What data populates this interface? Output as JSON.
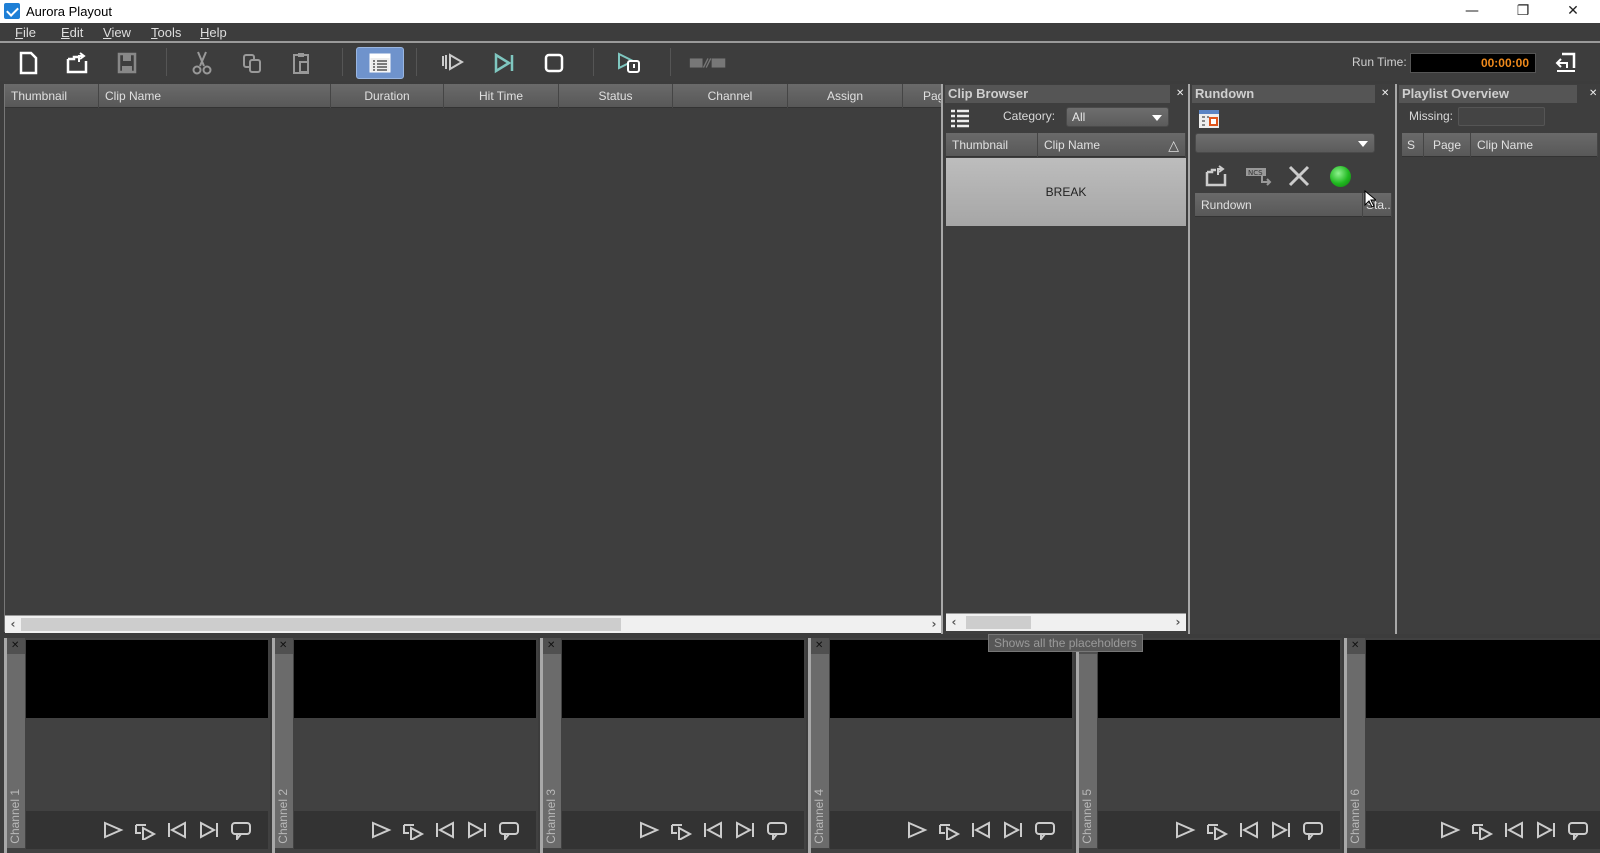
{
  "window": {
    "title": "Aurora Playout",
    "controls": {
      "minimize": "—",
      "restore": "❐",
      "close": "✕"
    }
  },
  "menu": [
    {
      "label": "File",
      "mnemonic": "F",
      "rest": "ile"
    },
    {
      "label": "Edit",
      "mnemonic": "E",
      "rest": "dit"
    },
    {
      "label": "View",
      "mnemonic": "V",
      "rest": "iew"
    },
    {
      "label": "Tools",
      "mnemonic": "T",
      "rest": "ools"
    },
    {
      "label": "Help",
      "mnemonic": "H",
      "rest": "elp"
    }
  ],
  "toolbar": {
    "buttons": [
      {
        "name": "new-icon"
      },
      {
        "name": "open-icon"
      },
      {
        "name": "save-icon"
      },
      {
        "name": "cut-icon"
      },
      {
        "name": "copy-icon"
      },
      {
        "name": "paste-icon"
      },
      {
        "name": "playlist-view-icon",
        "active": true
      },
      {
        "name": "cue-play-icon"
      },
      {
        "name": "play-next-icon"
      },
      {
        "name": "stop-icon"
      },
      {
        "name": "preview-play-icon"
      },
      {
        "name": "mos-ncs-icon"
      }
    ],
    "run_time_label": "Run Time:",
    "run_time_value": "00:00:00"
  },
  "playlist": {
    "columns": [
      "Thumbnail",
      "Clip Name",
      "Duration",
      "Hit Time",
      "Status",
      "Channel",
      "Assign",
      "Page"
    ],
    "rows": [],
    "hscroll_visible_fraction": 0.65
  },
  "clip_browser": {
    "title": "Clip Browser",
    "category_label": "Category:",
    "category_value": "All",
    "columns": [
      "Thumbnail",
      "Clip Name"
    ],
    "sort_indicator": "△",
    "items": [
      {
        "clip_name": "BREAK"
      }
    ]
  },
  "rundown": {
    "title": "Rundown",
    "selected_value": "",
    "columns": [
      "Rundown",
      "Sta..."
    ],
    "status_color": "#22c022"
  },
  "playlist_overview": {
    "title": "Playlist Overview",
    "missing_label": "Missing:",
    "missing_value": "",
    "columns": [
      "S",
      "Page",
      "Clip Name"
    ]
  },
  "channels": [
    {
      "label": "Channel 1"
    },
    {
      "label": "Channel 2"
    },
    {
      "label": "Channel 3"
    },
    {
      "label": "Channel 4"
    },
    {
      "label": "Channel 5"
    },
    {
      "label": "Channel 6"
    }
  ],
  "tooltip": "Shows all the placeholders",
  "accent": {
    "runtime": "#f08a1c",
    "active_button": "#6f93cc"
  }
}
